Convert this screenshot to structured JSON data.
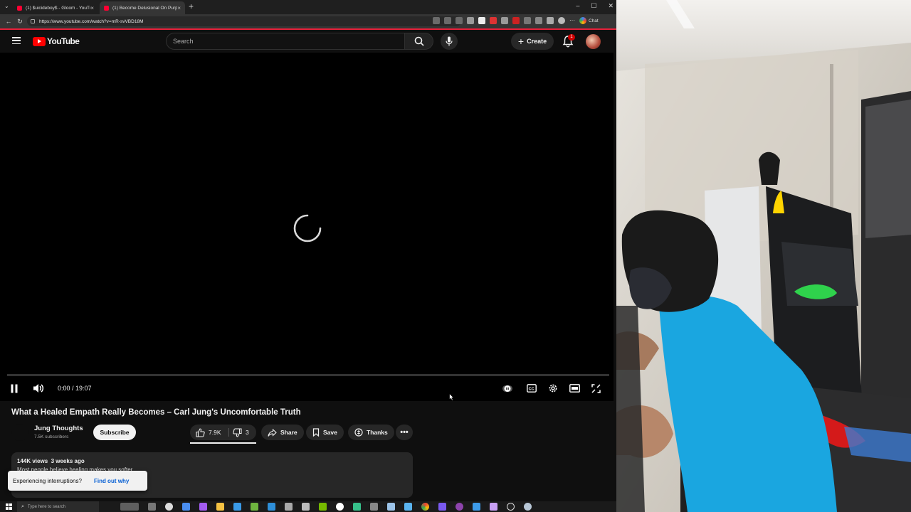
{
  "browser": {
    "tabs": [
      {
        "title": "(1) $uicideboy$ - Gloom - YouTub",
        "active": false
      },
      {
        "title": "(1) Become Delusional On Purpos",
        "active": true
      }
    ],
    "url": "https://www.youtube.com/watch?v=mR-svVBD18M",
    "chat_label": "Chat"
  },
  "yt_header": {
    "logo_text": "YouTube",
    "search_placeholder": "Search",
    "create_label": "Create",
    "notification_count": "1"
  },
  "player": {
    "time_display": "0:00 / 19:07",
    "state": "loading",
    "progress": 0.0
  },
  "video": {
    "title": "What a Healed Empath Really Becomes – Carl Jung's Uncomfortable Truth",
    "channel_name": "Jung Thoughts",
    "channel_subs": "7.5K subscribers",
    "subscribe_label": "Subscribe",
    "likes": "7.9K",
    "dislikes": "3",
    "share_label": "Share",
    "save_label": "Save",
    "thanks_label": "Thanks",
    "more_label": "•••"
  },
  "description": {
    "stats": "144K views  3 weeks ago",
    "preview": "Most people believe healing makes you softer..."
  },
  "toast": {
    "message": "Experiencing interruptions?",
    "link": "Find out why"
  },
  "taskbar": {
    "search_placeholder": "Type here to search"
  },
  "colors": {
    "accent_red": "#ff0000",
    "bg": "#0f0f0f",
    "pill_bg": "#272727",
    "link_blue": "#065fd4",
    "shirt_blue": "#1aa6e0"
  }
}
